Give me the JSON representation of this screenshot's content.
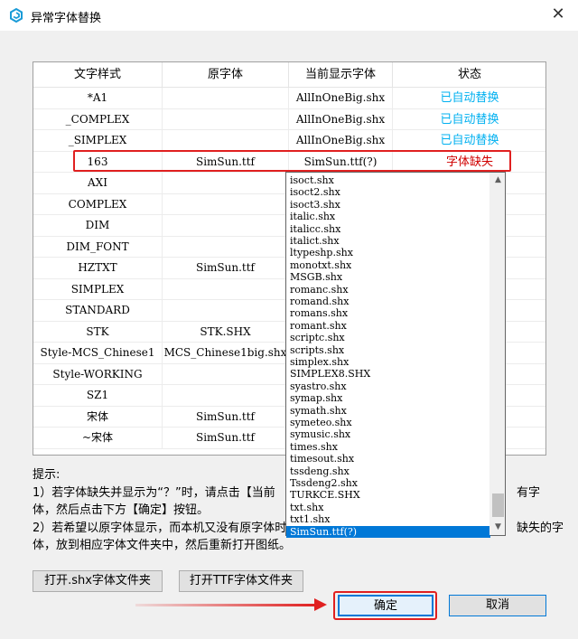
{
  "window": {
    "title": "异常字体替换",
    "close_symbol": "✕"
  },
  "table": {
    "headers": [
      "文字样式",
      "原字体",
      "当前显示字体",
      "状态"
    ],
    "rows": [
      {
        "style": "*A1",
        "original": "",
        "current": "AllInOneBig.shx",
        "status": "已自动替换",
        "status_type": "ok"
      },
      {
        "style": "_COMPLEX",
        "original": "",
        "current": "AllInOneBig.shx",
        "status": "已自动替换",
        "status_type": "ok"
      },
      {
        "style": "_SIMPLEX",
        "original": "",
        "current": "AllInOneBig.shx",
        "status": "已自动替换",
        "status_type": "ok"
      },
      {
        "style": "163",
        "original": "SimSun.ttf",
        "current": "SimSun.ttf(?)",
        "status": "字体缺失",
        "status_type": "missing"
      },
      {
        "style": "AXI",
        "original": "",
        "current": "",
        "status": "",
        "status_type": ""
      },
      {
        "style": "COMPLEX",
        "original": "",
        "current": "",
        "status": "",
        "status_type": ""
      },
      {
        "style": "DIM",
        "original": "",
        "current": "",
        "status": "",
        "status_type": ""
      },
      {
        "style": "DIM_FONT",
        "original": "",
        "current": "",
        "status": "",
        "status_type": ""
      },
      {
        "style": "HZTXT",
        "original": "SimSun.ttf",
        "current": "",
        "status": "",
        "status_type": ""
      },
      {
        "style": "SIMPLEX",
        "original": "",
        "current": "",
        "status": "",
        "status_type": ""
      },
      {
        "style": "STANDARD",
        "original": "",
        "current": "",
        "status": "",
        "status_type": ""
      },
      {
        "style": "STK",
        "original": "STK.SHX",
        "current": "",
        "status": "",
        "status_type": ""
      },
      {
        "style": "Style-MCS_Chinese1",
        "original": "MCS_Chinese1big.shx",
        "current": "",
        "status": "",
        "status_type": ""
      },
      {
        "style": "Style-WORKING",
        "original": "",
        "current": "",
        "status": "",
        "status_type": ""
      },
      {
        "style": "SZ1",
        "original": "",
        "current": "",
        "status": "",
        "status_type": ""
      },
      {
        "style": "宋体",
        "original": "SimSun.ttf",
        "current": "",
        "status": "",
        "status_type": ""
      },
      {
        "style": "~宋体",
        "original": "SimSun.ttf",
        "current": "",
        "status": "",
        "status_type": ""
      }
    ]
  },
  "dropdown": {
    "items": [
      "isoct.shx",
      "isoct2.shx",
      "isoct3.shx",
      "italic.shx",
      "italicc.shx",
      "italict.shx",
      "ltypeshp.shx",
      "monotxt.shx",
      "MSGB.shx",
      "romanc.shx",
      "romand.shx",
      "romans.shx",
      "romant.shx",
      "scriptc.shx",
      "scripts.shx",
      "simplex.shx",
      "SIMPLEX8.SHX",
      "syastro.shx",
      "symap.shx",
      "symath.shx",
      "symeteo.shx",
      "symusic.shx",
      "times.shx",
      "timesout.shx",
      "tssdeng.shx",
      "Tssdeng2.shx",
      "TURKCE.SHX",
      "txt.shx",
      "txt1.shx",
      "SimSun.ttf(?)"
    ],
    "selected_index": 29,
    "up_arrow": "▲",
    "down_arrow": "▼"
  },
  "tips": {
    "heading": "提示:",
    "line1_start": "1）若字体缺失并显示为“？”时，请点击【当前",
    "line1_end": "有字",
    "line2": "体，然后点击下方【确定】按钮。",
    "line3_start": "2）若希望以原字体显示，而本机又没有原字体时",
    "line3_end": "缺失的字",
    "line4": "体，放到相应字体文件夹中，然后重新打开图纸。"
  },
  "buttons": {
    "open_shx": "打开.shx字体文件夹",
    "open_ttf": "打开TTF字体文件夹",
    "ok": "确定",
    "cancel": "取消"
  }
}
